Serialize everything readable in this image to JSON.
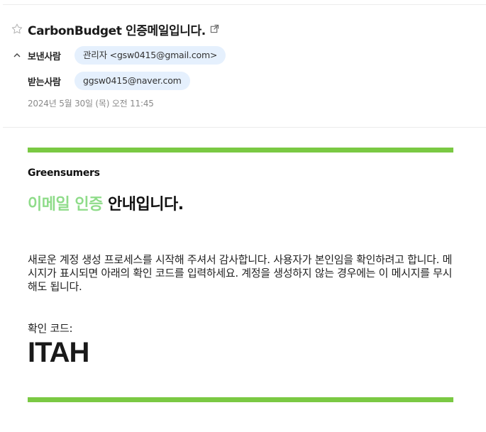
{
  "header": {
    "subject": "CarbonBudget 인증메일입니다.",
    "from_label": "보낸사람",
    "from_value": "관리자 <gsw0415@gmail.com>",
    "to_label": "받는사람",
    "to_value": "ggsw0415@naver.com",
    "date": "2024년 5월 30일 (목) 오전 11:45"
  },
  "icons": {
    "star": "star-outline-icon",
    "external": "open-in-new-window-icon",
    "collapse": "chevron-up-icon"
  },
  "body": {
    "brand": "Greensumers",
    "headline_highlight": "이메일 인증",
    "headline_rest": " 안내입니다.",
    "paragraph": "새로운 계정 생성 프로세스를 시작해 주셔서 감사합니다. 사용자가 본인임을 확인하려고 합니다. 메시지가 표시되면 아래의 확인 코드를 입력하세요. 계정을 생성하지 않는 경우에는 이 메시지를 무시해도 됩니다.",
    "code_label": "확인 코드:",
    "code": "ITAH"
  },
  "colors": {
    "accent_green": "#7ac943",
    "headline_green": "#8fdc8a",
    "chip_bg": "#e5f0fd"
  }
}
